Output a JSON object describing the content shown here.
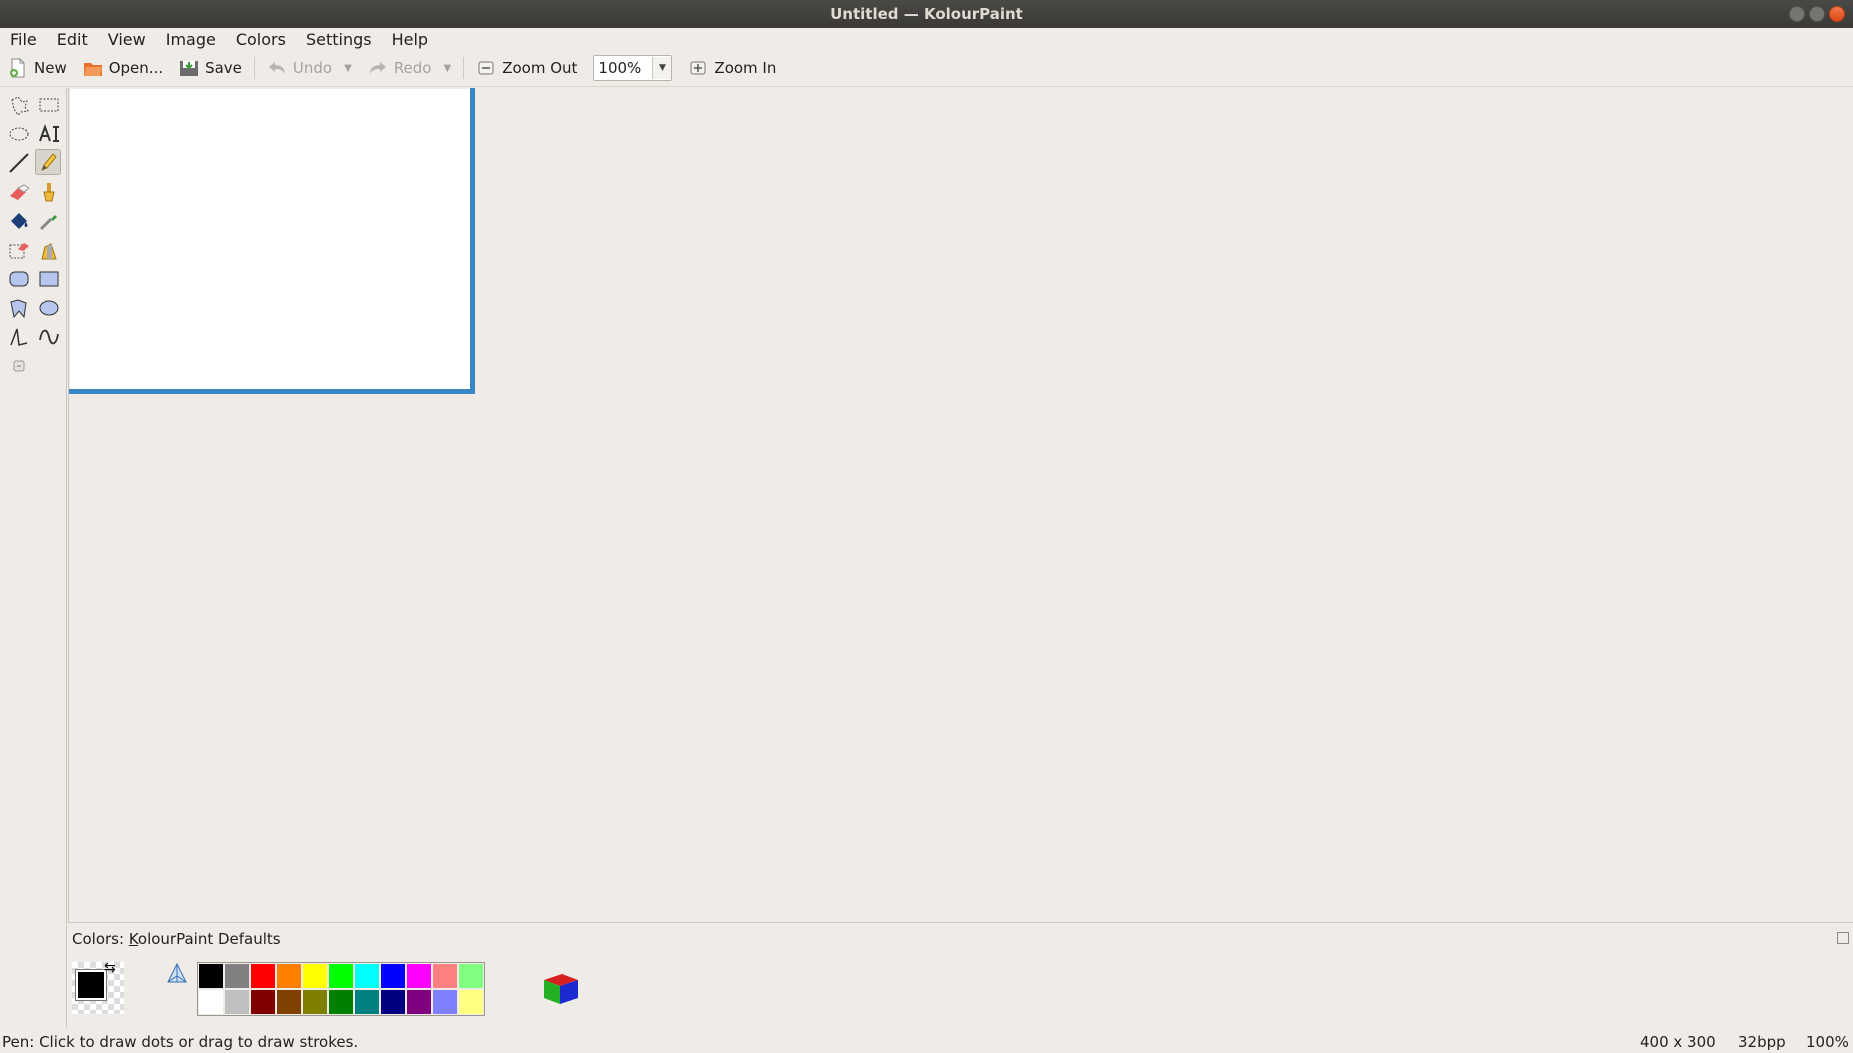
{
  "window": {
    "title": "Untitled  — KolourPaint"
  },
  "menubar": {
    "items": [
      "File",
      "Edit",
      "View",
      "Image",
      "Colors",
      "Settings",
      "Help"
    ]
  },
  "toolbar": {
    "new_label": "New",
    "open_label": "Open...",
    "save_label": "Save",
    "undo_label": "Undo",
    "redo_label": "Redo",
    "zoom_out_label": "Zoom Out",
    "zoom_value": "100%",
    "zoom_in_label": "Zoom In"
  },
  "tools": [
    "free-form-selection",
    "rectangular-selection",
    "elliptical-selection",
    "text",
    "line",
    "pen",
    "eraser",
    "brush",
    "flood-fill",
    "color-picker",
    "color-eraser",
    "spraycan",
    "rounded-rectangle",
    "rectangle",
    "polygon",
    "ellipse",
    "connected-lines",
    "curve",
    "zoom"
  ],
  "active_tool": "pen",
  "colors_panel": {
    "title_prefix": "Colors: ",
    "title_underlined": "K",
    "title_rest": "olourPaint Defaults",
    "foreground": "#000000",
    "palette_top": [
      "#000000",
      "#808080",
      "#ff0000",
      "#ff8000",
      "#ffff00",
      "#00ff00",
      "#00ffff",
      "#0000ff",
      "#ff00ff",
      "#ff8080",
      "#80ff80"
    ],
    "palette_bottom": [
      "#ffffff",
      "#c0c0c0",
      "#800000",
      "#804000",
      "#808000",
      "#008000",
      "#008080",
      "#000080",
      "#800080",
      "#8080ff",
      "#ffff80"
    ]
  },
  "status": {
    "message": "Pen: Click to draw dots or drag to draw strokes.",
    "image_size": "400 x 300",
    "color_depth": "32bpp",
    "zoom": "100%"
  }
}
